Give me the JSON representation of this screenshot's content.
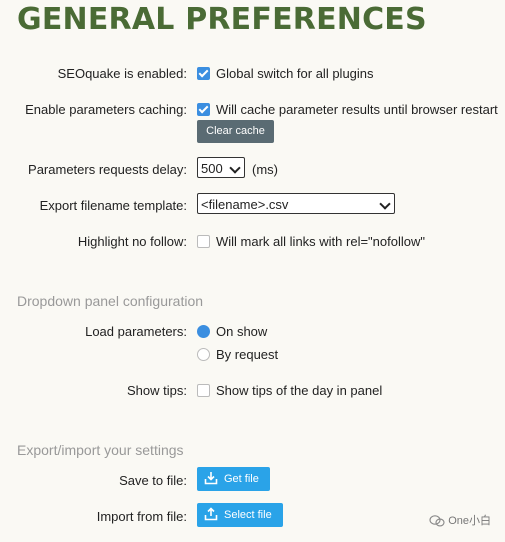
{
  "title": "GENERAL PREFERENCES",
  "rows": {
    "enabled": {
      "label": "SEOquake is enabled:",
      "text": "Global switch for all plugins",
      "checked": true
    },
    "caching": {
      "label": "Enable parameters caching:",
      "text": "Will cache parameter results until browser restart",
      "checked": true,
      "button": "Clear cache"
    },
    "delay": {
      "label": "Parameters requests delay:",
      "value": "500",
      "unit": "(ms)"
    },
    "export_template": {
      "label": "Export filename template:",
      "value": "<filename>.csv"
    },
    "nofollow": {
      "label": "Highlight no follow:",
      "text": "Will mark all links with rel=\"nofollow\"",
      "checked": false
    }
  },
  "dropdown_section": {
    "heading": "Dropdown panel configuration",
    "load_label": "Load parameters:",
    "options": [
      "On show",
      "By request"
    ],
    "selected": "On show",
    "tips_label": "Show tips:",
    "tips_text": "Show tips of the day in panel",
    "tips_checked": false
  },
  "export_section": {
    "heading": "Export/import your settings",
    "save_label": "Save to file:",
    "save_button": "Get file",
    "import_label": "Import from file:",
    "import_button": "Select file"
  },
  "watermark": "One小白",
  "colors": {
    "title": "#4a6b35",
    "accent": "#3b8ee0",
    "blue_button": "#2aa3e8",
    "gray_button": "#5a6b73"
  }
}
